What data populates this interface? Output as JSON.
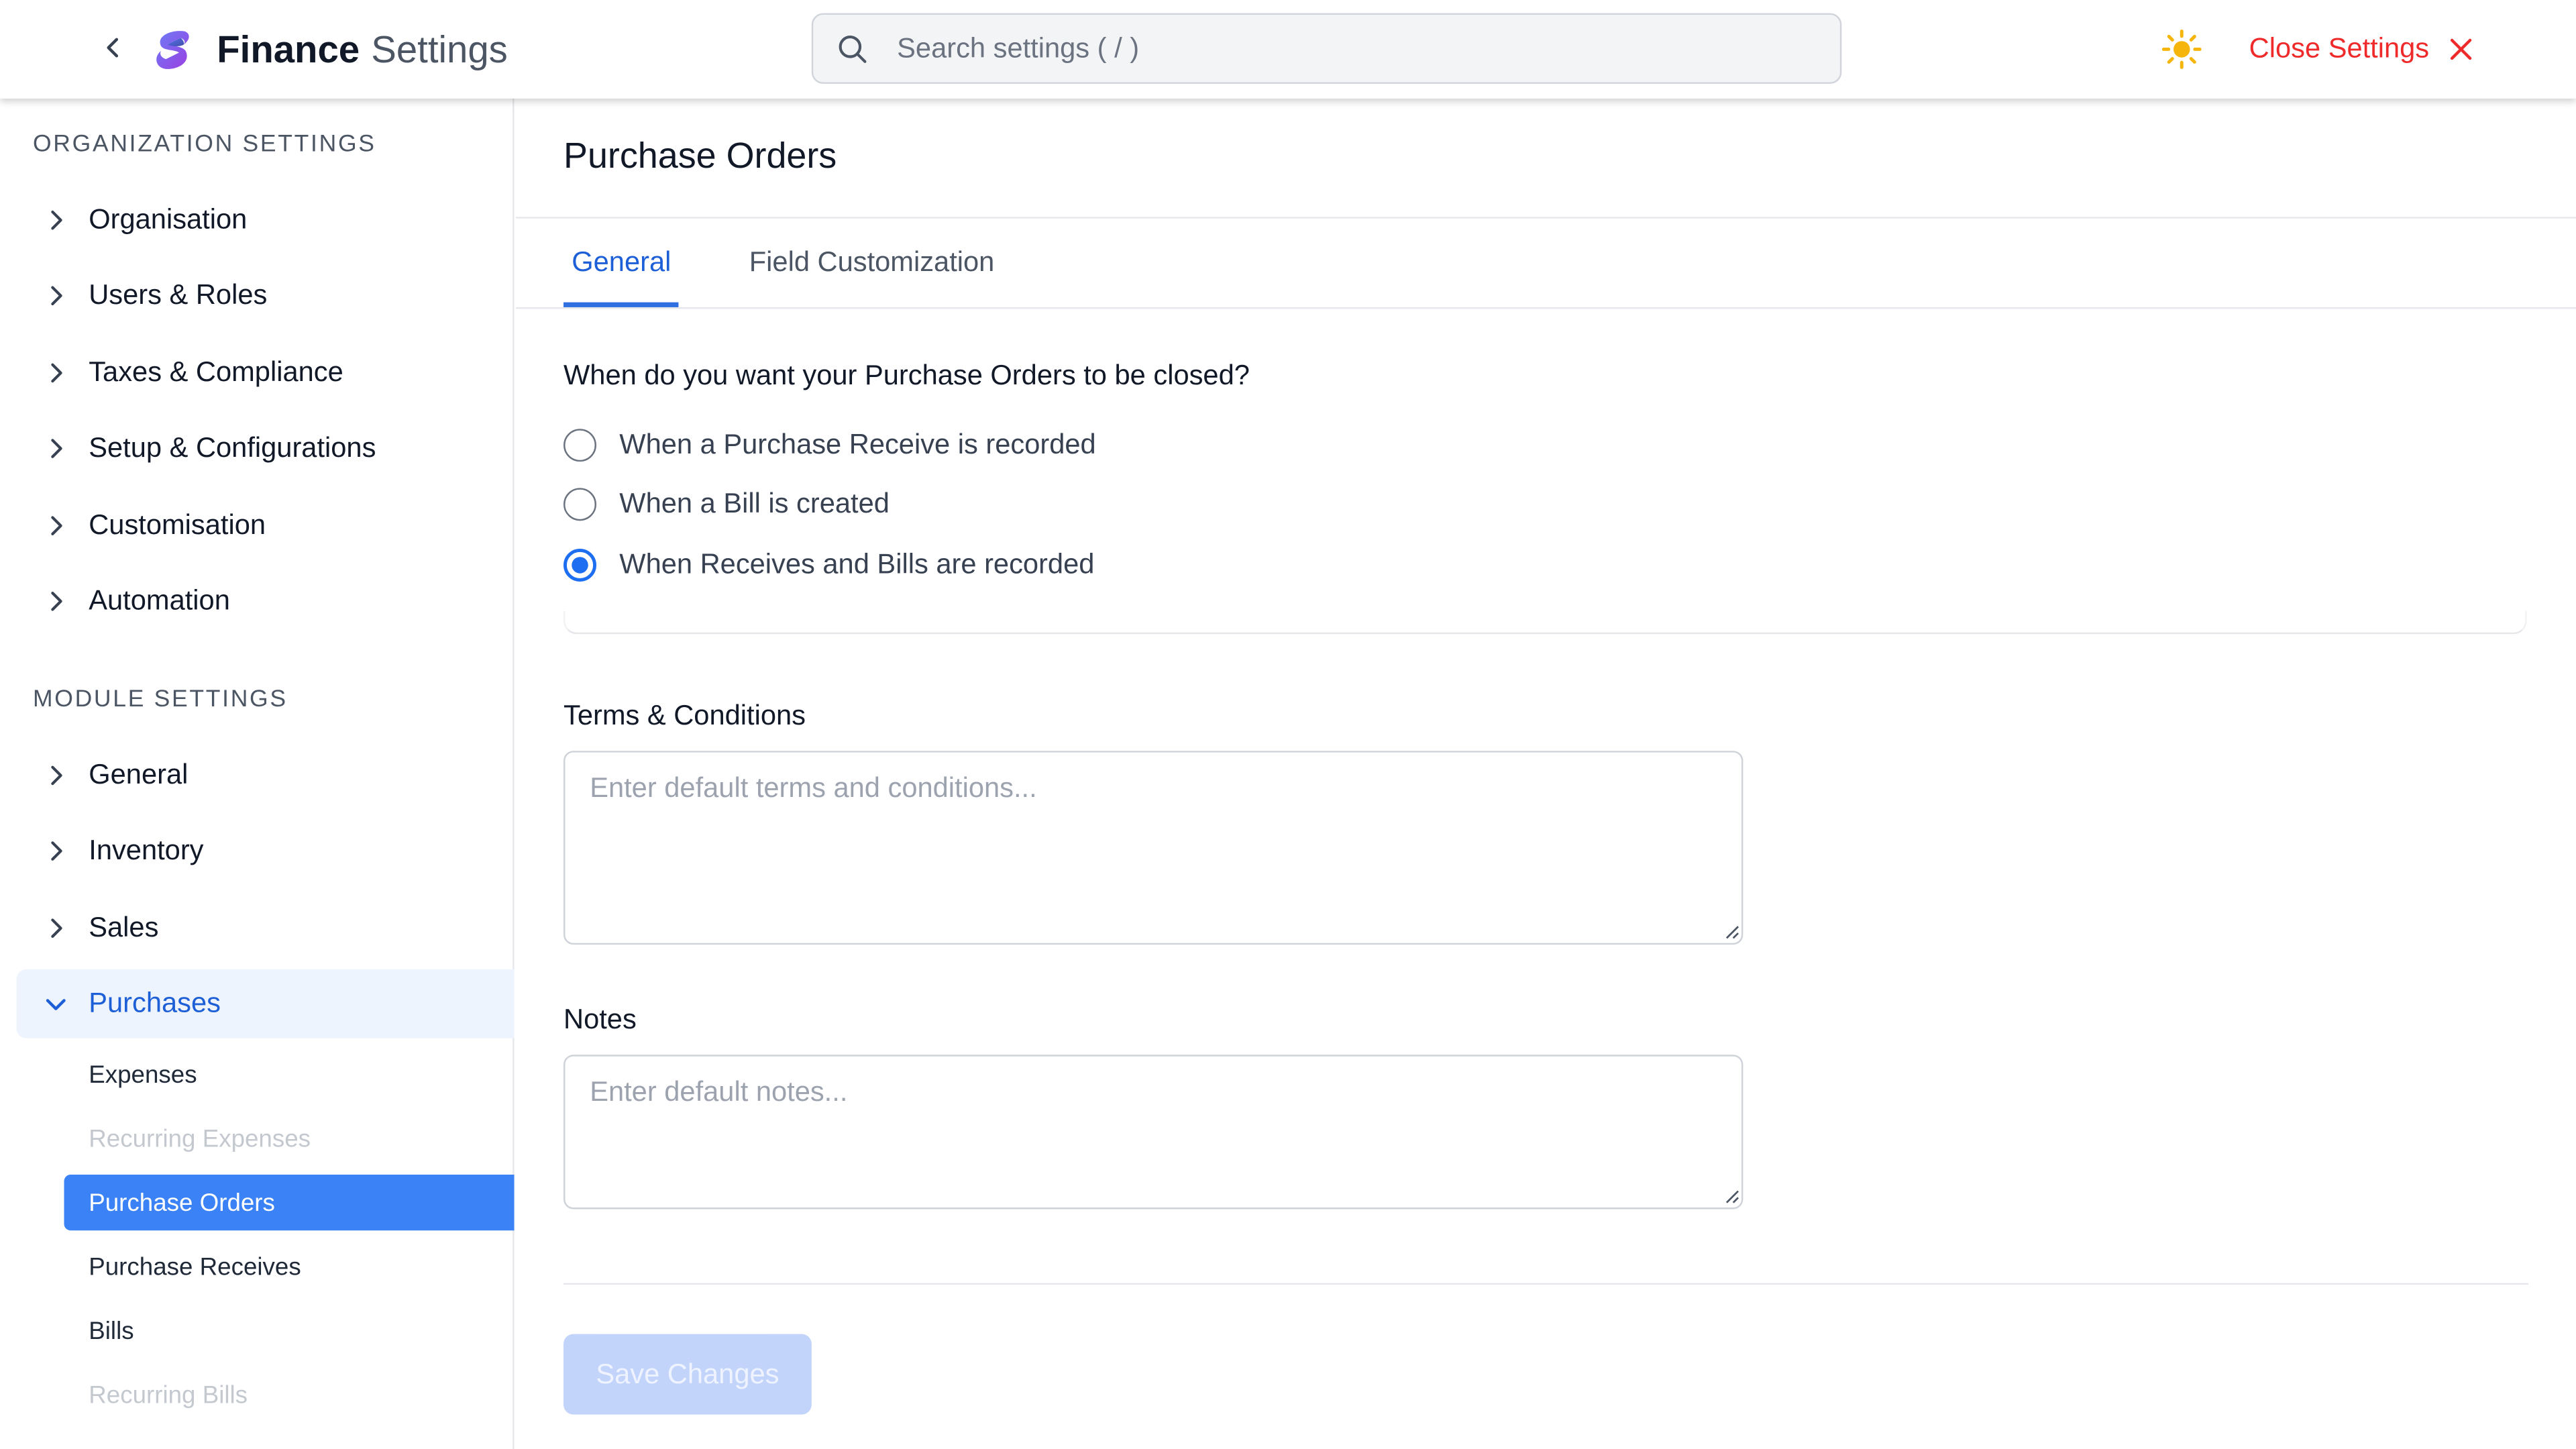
{
  "header": {
    "back_icon": "chevron-left-icon",
    "logo_icon": "s-logo-icon",
    "title_strong": "Finance",
    "title_light": "Settings",
    "search_placeholder": "Search settings ( / )",
    "search_value": "",
    "theme_icon": "sun-icon",
    "close_label": "Close Settings",
    "close_icon": "x-icon"
  },
  "sidebar": {
    "org_heading": "ORGANIZATION SETTINGS",
    "org_items": [
      {
        "label": "Organisation"
      },
      {
        "label": "Users & Roles"
      },
      {
        "label": "Taxes & Compliance"
      },
      {
        "label": "Setup & Configurations"
      },
      {
        "label": "Customisation"
      },
      {
        "label": "Automation"
      }
    ],
    "module_heading": "MODULE SETTINGS",
    "module_items": [
      {
        "label": "General"
      },
      {
        "label": "Inventory"
      },
      {
        "label": "Sales"
      },
      {
        "label": "Purchases",
        "expanded": true
      }
    ],
    "purchases_sub_items": [
      {
        "label": "Expenses",
        "state": "normal"
      },
      {
        "label": "Recurring Expenses",
        "state": "disabled"
      },
      {
        "label": "Purchase Orders",
        "state": "selected"
      },
      {
        "label": "Purchase Receives",
        "state": "normal"
      },
      {
        "label": "Bills",
        "state": "normal"
      },
      {
        "label": "Recurring Bills",
        "state": "disabled"
      }
    ]
  },
  "main": {
    "page_title": "Purchase Orders",
    "tabs": [
      {
        "label": "General",
        "active": true
      },
      {
        "label": "Field Customization",
        "active": false
      }
    ],
    "question": "When do you want your Purchase Orders to be closed?",
    "options": [
      {
        "label": "When a Purchase Receive is recorded",
        "checked": false
      },
      {
        "label": "When a Bill is created",
        "checked": false
      },
      {
        "label": "When Receives and Bills are recorded",
        "checked": true
      }
    ],
    "terms_label": "Terms & Conditions",
    "terms_placeholder": "Enter default terms and conditions...",
    "terms_value": "",
    "notes_label": "Notes",
    "notes_placeholder": "Enter default notes...",
    "notes_value": "",
    "save_label": "Save Changes",
    "save_enabled": false
  },
  "colors": {
    "accent": "#1d5fd6",
    "selected_bg": "#3b82f6",
    "active_nav_bg": "#eef4fe",
    "danger": "#ef2a2a",
    "sun": "#f5b50a",
    "save_disabled_bg": "#c3d4fb"
  }
}
